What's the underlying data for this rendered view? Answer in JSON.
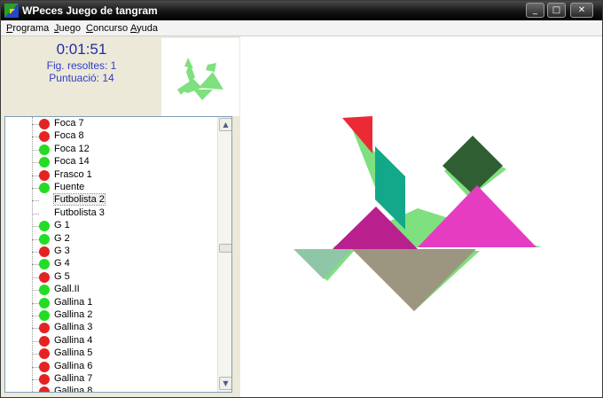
{
  "window": {
    "title": "WPeces Juego de tangram",
    "minimize_glyph": "_",
    "maximize_glyph": "□",
    "close_glyph": "✕"
  },
  "menu": [
    {
      "label": "Programa"
    },
    {
      "label": "Juego"
    },
    {
      "label": "Concurso"
    },
    {
      "label": "Ayuda"
    }
  ],
  "status": {
    "timer": "0:01:51",
    "figures_solved": "Fig. resoltes: 1",
    "score": "Puntuació: 14"
  },
  "colors": {
    "timer": "#1e2ea8",
    "solved_dot": "#22dd22",
    "unsolved_dot": "#e52222",
    "preview_shape": "#7ee07e"
  },
  "figure_list": [
    {
      "label": "Foca  7",
      "status": "red"
    },
    {
      "label": "Foca  8",
      "status": "red"
    },
    {
      "label": "Foca 12",
      "status": "green"
    },
    {
      "label": "Foca 14",
      "status": "green"
    },
    {
      "label": "Frasco  1",
      "status": "red"
    },
    {
      "label": "Fuente",
      "status": "green"
    },
    {
      "label": "Futbolista  2",
      "status": "none",
      "selected": true
    },
    {
      "label": "Futbolista  3",
      "status": "none"
    },
    {
      "label": "G  1",
      "status": "green"
    },
    {
      "label": "G  2",
      "status": "green"
    },
    {
      "label": "G  3",
      "status": "red"
    },
    {
      "label": "G  4",
      "status": "green"
    },
    {
      "label": "G  5",
      "status": "red"
    },
    {
      "label": "Gall.II",
      "status": "green"
    },
    {
      "label": "Gallina  1",
      "status": "green"
    },
    {
      "label": "Gallina  2",
      "status": "green"
    },
    {
      "label": "Gallina  3",
      "status": "red"
    },
    {
      "label": "Gallina  4",
      "status": "red"
    },
    {
      "label": "Gallina  5",
      "status": "red"
    },
    {
      "label": "Gallina  6",
      "status": "red"
    },
    {
      "label": "Gallina  7",
      "status": "red"
    },
    {
      "label": "Gallina  8",
      "status": "red"
    }
  ],
  "scrollbar": {
    "up_glyph": "▲",
    "down_glyph": "▼"
  },
  "tangram_pieces": [
    {
      "name": "small-triangle-red",
      "color": "#ec2a36"
    },
    {
      "name": "parallelogram-teal",
      "color": "#14a88a"
    },
    {
      "name": "square-dark-green",
      "color": "#2f5e33"
    },
    {
      "name": "medium-triangle-magenta",
      "color": "#b8208e"
    },
    {
      "name": "large-triangle-pink",
      "color": "#e63cc2"
    },
    {
      "name": "small-triangle-mint",
      "color": "#8fc6a8"
    },
    {
      "name": "large-triangle-taupe",
      "color": "#9c9680"
    }
  ]
}
